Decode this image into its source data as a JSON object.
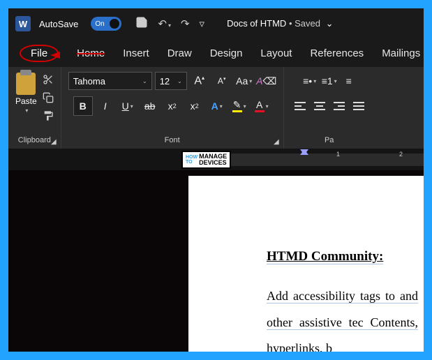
{
  "titlebar": {
    "autosave_label": "AutoSave",
    "autosave_state": "On",
    "doc_name": "Docs of HTMD",
    "doc_status": "Saved"
  },
  "tabs": {
    "file": "File",
    "home": "Home",
    "insert": "Insert",
    "draw": "Draw",
    "design": "Design",
    "layout": "Layout",
    "references": "References",
    "mailings": "Mailings"
  },
  "ribbon": {
    "clipboard": {
      "paste": "Paste",
      "label": "Clipboard"
    },
    "font": {
      "name": "Tahoma",
      "size": "12",
      "label": "Font"
    },
    "paragraph": {
      "label": "Pa"
    }
  },
  "ruler": {
    "num1": "1",
    "num2": "2"
  },
  "logo": {
    "how": "HOW",
    "to": "TO",
    "line1": "MANAGE",
    "line2": "DEVICES"
  },
  "document": {
    "heading": "HTMD Community:",
    "body": "Add accessibility tags to and other assistive tec Contents, hyperlinks, b"
  }
}
